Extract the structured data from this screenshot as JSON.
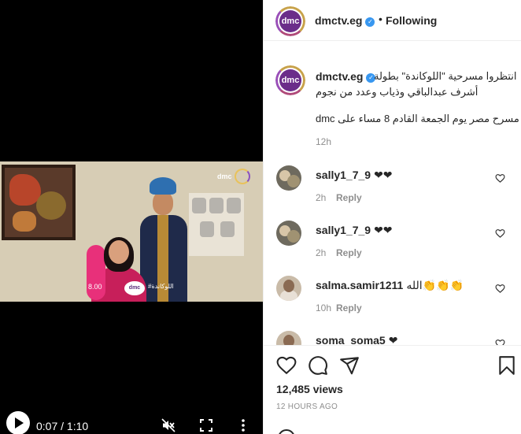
{
  "video": {
    "time": "0:07 / 1:10",
    "watermark": "dmc",
    "overlay_time": "8.00",
    "overlay_logo": "dmc",
    "overlay_hashtag": "#اللوكاندة"
  },
  "header": {
    "username": "dmctv.eg",
    "avatar_text": "dmc",
    "separator": "•",
    "follow_label": "Following"
  },
  "caption": {
    "username": "dmctv.eg",
    "avatar_text": "dmc",
    "line1": "انتظروا مسرحية \"اللوكاندة\" بطولة",
    "line2": "أشرف عبدالباقي وذياب وعدد من نجوم",
    "line3": "مسرح مصر يوم الجمعة القادم 8 مساء على dmc",
    "time": "12h"
  },
  "comments": [
    {
      "user": "sally1_7_9",
      "text": "❤❤",
      "time": "2h",
      "reply": "Reply"
    },
    {
      "user": "sally1_7_9",
      "text": "❤❤",
      "time": "2h",
      "reply": "Reply"
    },
    {
      "user": "salma.samir1211",
      "text": "الله👏👏👏",
      "time": "10h",
      "reply": "Reply"
    },
    {
      "user": "soma_soma5",
      "text": "❤",
      "time": "",
      "reply": ""
    }
  ],
  "stats": {
    "views": "12,485 views",
    "posted": "12 HOURS AGO"
  },
  "icons": {
    "like": "heart-outline-icon",
    "comment": "speech-bubble-icon",
    "share": "paper-plane-icon",
    "save": "bookmark-icon",
    "play": "play-icon",
    "mute": "speaker-muted-icon",
    "fullscreen": "fullscreen-icon",
    "more": "vertical-dots-icon"
  },
  "colors": {
    "verified": "#3897f0",
    "muted_text": "#8e8e8e",
    "brand_purple": "#6b2d8a"
  }
}
